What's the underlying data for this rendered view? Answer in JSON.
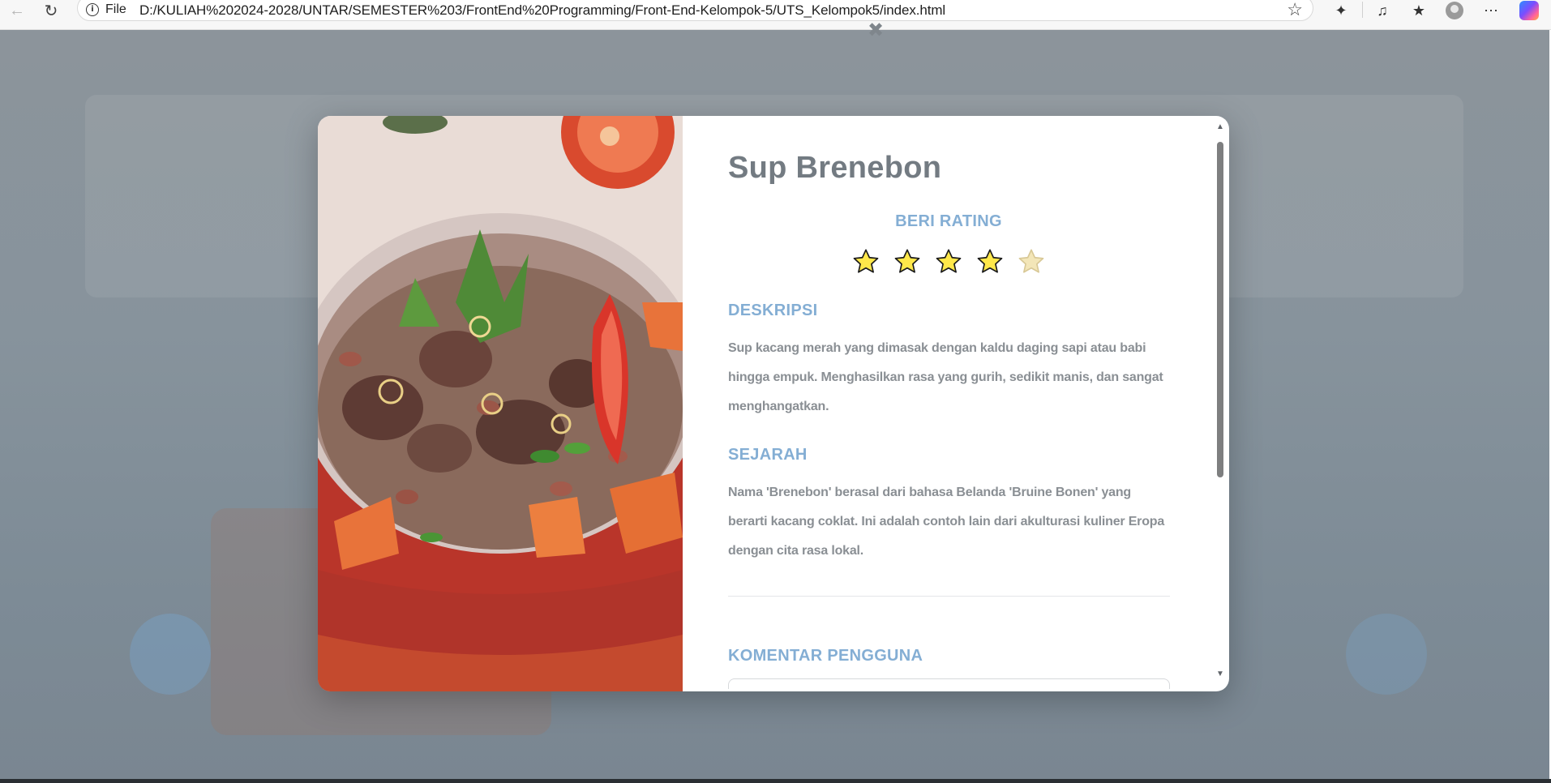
{
  "browser": {
    "url_prefix": "File",
    "url": "D:/KULIAH%202024-2028/UNTAR/SEMESTER%203/FrontEnd%20Programming/Front-End-Kelompok-5/UTS_Kelompok5/index.html",
    "icons": [
      "back-icon",
      "reload-icon",
      "info-icon",
      "favorite-star-icon",
      "extensions-icon",
      "read-aloud-icon",
      "favorites-icon",
      "profile-icon",
      "more-icon",
      "copilot-icon"
    ]
  },
  "modal": {
    "title": "Sup Brenebon",
    "rating": {
      "heading": "BERI RATING",
      "value": 4,
      "max": 5,
      "filled_color": "#ffe84a",
      "empty_color": "#f3e6b8"
    },
    "description": {
      "heading": "DESKRIPSI",
      "text": "Sup kacang merah yang dimasak dengan kaldu daging sapi atau babi hingga empuk. Menghasilkan rasa yang gurih, sedikit manis, dan sangat menghangatkan."
    },
    "history": {
      "heading": "SEJARAH",
      "text": "Nama 'Brenebon' berasal dari bahasa Belanda 'Bruine Bonen' yang berarti kacang coklat. Ini adalah contoh lain dari akulturasi kuliner Eropa dengan cita rasa lokal."
    },
    "comments": {
      "heading": "KOMENTAR PENGGUNA"
    },
    "close_symbol": "✖"
  },
  "colors": {
    "accent": "#84aed4",
    "title": "#737b82",
    "body_text": "#8a8f94"
  }
}
